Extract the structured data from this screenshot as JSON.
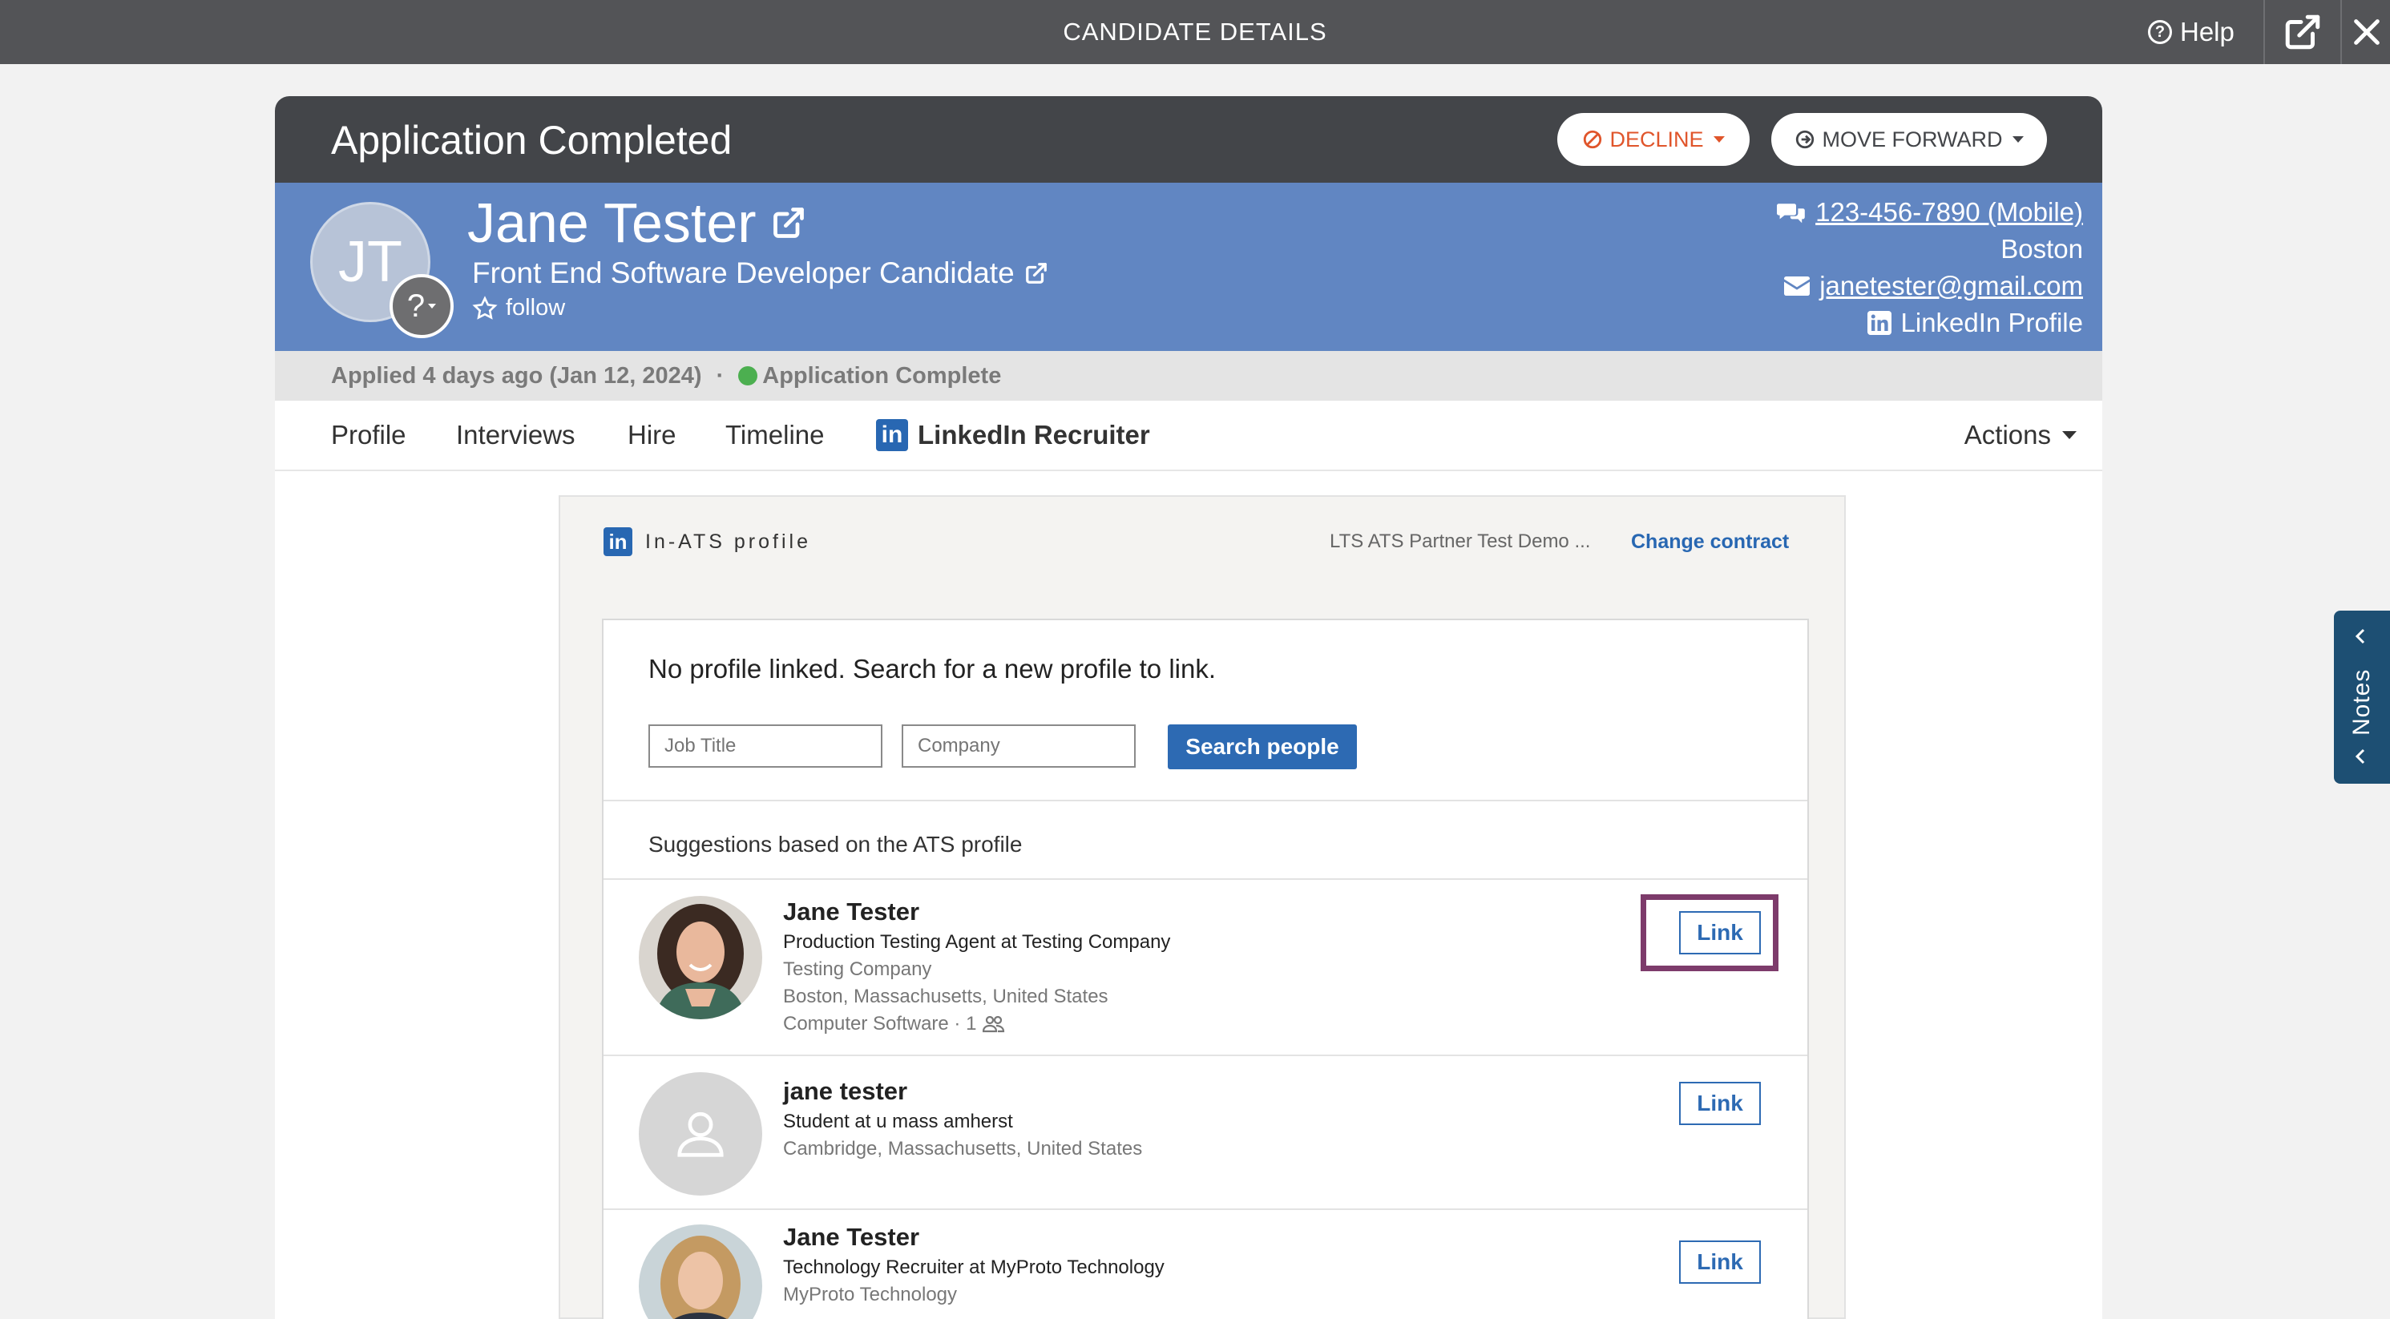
{
  "topbar": {
    "title": "CANDIDATE DETAILS",
    "help_label": "Help",
    "help_icon": "question-circle-icon",
    "external_icon": "external-link-icon",
    "close_icon": "close-icon"
  },
  "status": {
    "title": "Application Completed",
    "decline_label": "DECLINE",
    "move_forward_label": "MOVE FORWARD"
  },
  "candidate": {
    "initials": "JT",
    "badge": "?",
    "name": "Jane Tester",
    "role": "Front End Software Developer Candidate",
    "follow_label": "follow",
    "phone": "123-456-7890 (Mobile)",
    "location": "Boston",
    "email": "janetester@gmail.com",
    "linkedin_label": "LinkedIn Profile"
  },
  "applied": {
    "text": "Applied 4 days ago (Jan 12, 2024)",
    "separator": "·",
    "status": "Application Complete",
    "status_color": "#4caf50"
  },
  "tabs": {
    "profile": "Profile",
    "interviews": "Interviews",
    "hire": "Hire",
    "timeline": "Timeline",
    "linkedin": "LinkedIn Recruiter",
    "li_logo": "in",
    "actions": "Actions"
  },
  "linkedin_panel": {
    "title": "In-ATS profile",
    "contract_name": "LTS ATS Partner Test Demo ...",
    "change_contract": "Change contract",
    "heading": "No profile linked. Search for a new profile to link.",
    "job_title_placeholder": "Job Title",
    "company_placeholder": "Company",
    "search_button": "Search people",
    "suggestions_title": "Suggestions based on the ATS profile",
    "results": [
      {
        "name": "Jane Tester",
        "headline": "Production Testing Agent at Testing Company",
        "company": "Testing Company",
        "location": "Boston, Massachusetts, United States",
        "industry": "Computer Software · 1",
        "link_label": "Link"
      },
      {
        "name": "jane tester",
        "headline": "Student at u mass amherst",
        "location": "Cambridge, Massachusetts, United States",
        "link_label": "Link"
      },
      {
        "name": "Jane Tester",
        "headline": "Technology Recruiter at MyProto Technology",
        "company": "MyProto Technology",
        "link_label": "Link"
      }
    ]
  },
  "notes": {
    "label": "Notes"
  },
  "colors": {
    "topbar": "#535457",
    "header": "#434549",
    "profile_band": "#6186c2",
    "linkedin_blue": "#2867b2",
    "highlight": "#7d3b6b",
    "notes_tab": "#1d4f73"
  }
}
